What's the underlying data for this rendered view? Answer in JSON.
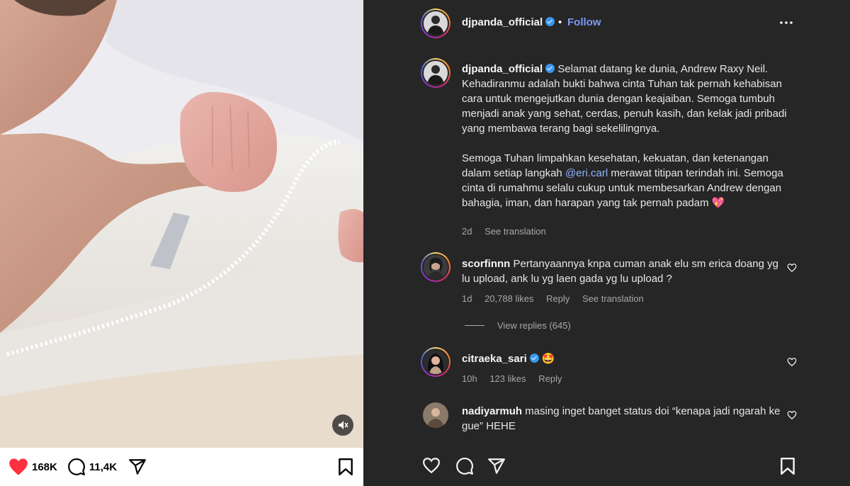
{
  "media": {
    "mute_icon": "speaker-muted-icon",
    "likes_count": "168K",
    "comments_count": "11,4K"
  },
  "post": {
    "username": "djpanda_official",
    "follow_label": "Follow",
    "separator": "•",
    "caption_p1": "Selamat datang ke dunia, Andrew Raxy Neil. Kehadiranmu adalah bukti bahwa cinta Tuhan tak pernah kehabisan cara untuk mengejutkan dunia dengan keajaiban. Semoga tumbuh menjadi anak yang sehat, cerdas, penuh kasih, dan kelak jadi pribadi yang membawa terang bagi sekelilingnya.",
    "caption_p2_a": "Semoga Tuhan limpahkan kesehatan, kekuatan, dan ketenangan dalam setiap langkah ",
    "caption_mention": "@eri.carl",
    "caption_p2_b": " merawat titipan terindah ini. Semoga cinta di rumahmu selalu cukup untuk membesarkan Andrew dengan bahagia, iman, dan harapan yang tak pernah padam",
    "caption_emoji": "💖",
    "time": "2d",
    "see_translation": "See translation"
  },
  "comments": [
    {
      "username": "scorfinnn",
      "text": "Pertanyaannya knpa cuman anak elu sm erica doang yg lu upload, ank lu yg laen gada yg lu upload ?",
      "time": "1d",
      "likes": "20,788 likes",
      "reply": "Reply",
      "see_translation": "See translation",
      "view_replies": "View replies (645)"
    },
    {
      "username": "citraeka_sari",
      "text": "🤩",
      "time": "10h",
      "likes": "123 likes",
      "reply": "Reply"
    },
    {
      "username": "nadiyarmuh",
      "text": "masing inget banget status doi “kenapa jadi ngarah ke gue” HEHE"
    }
  ],
  "colors": {
    "panel_bg": "#262626",
    "follow": "#7a9af6",
    "verified": "#3897f0",
    "like_red": "#ff3040"
  }
}
